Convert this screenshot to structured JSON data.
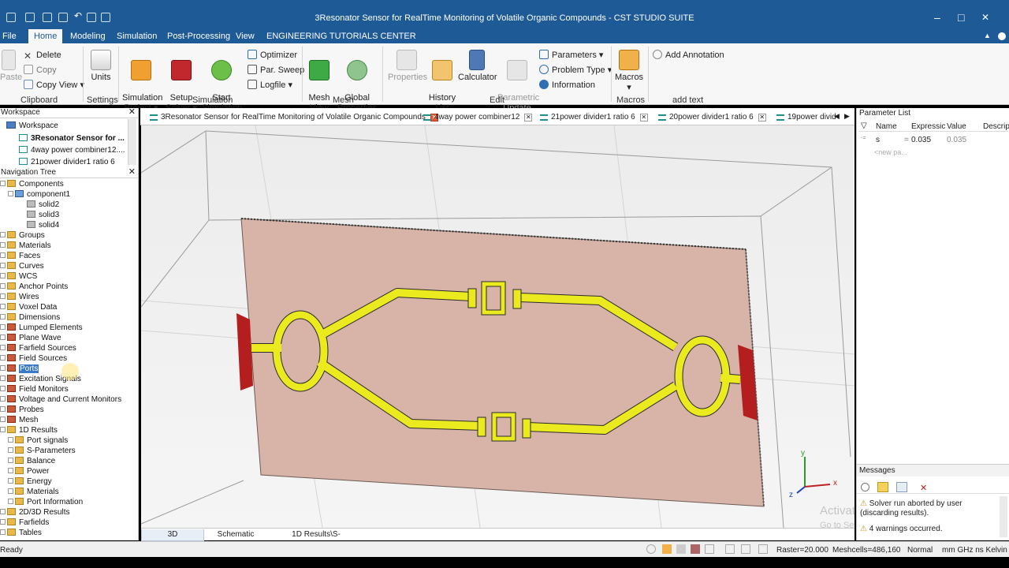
{
  "window": {
    "title": "3Resonator Sensor for RealTime Monitoring of Volatile Organic Compounds - CST STUDIO SUITE"
  },
  "menu": [
    "File",
    "Home",
    "Modeling",
    "Simulation",
    "Post-Processing",
    "View",
    "ENGINEERING TUTORIALS CENTER"
  ],
  "ribbon": {
    "clipboard": {
      "paste": "Paste",
      "delete": "Delete",
      "copy": "Copy",
      "copy_view": "Copy View",
      "group": "Clipboard"
    },
    "settings": {
      "units": "Units",
      "group": "Settings"
    },
    "simulation": {
      "sim_project": "Simulation\nProject",
      "setup_solver": "Setup\nSolver",
      "start_sim": "Start\nSimulation",
      "optimizer": "Optimizer",
      "par_sweep": "Par. Sweep",
      "logfile": "Logfile",
      "group": "Simulation"
    },
    "mesh": {
      "mesh_view": "Mesh\nView",
      "global_props": "Global\nProperties",
      "group": "Mesh"
    },
    "edit": {
      "properties": "Properties",
      "history": "History\nList",
      "calculator": "Calculator",
      "param_update": "Parametric\nUpdate",
      "parameters": "Parameters",
      "problem_type": "Problem Type",
      "information": "Information",
      "group": "Edit"
    },
    "macros": {
      "macros": "Macros",
      "group": "Macros"
    },
    "addtext": {
      "annotation": "Add Annotation",
      "group": "add text"
    }
  },
  "workspace": {
    "header": "Workspace",
    "root": "Workspace",
    "items": [
      "3Resonator Sensor for ...",
      "4way power combiner12....",
      "21power divider1 ratio 6"
    ]
  },
  "navtree": {
    "header": "Navigation Tree",
    "items": [
      {
        "label": "Components",
        "level": 0,
        "icon": "folder"
      },
      {
        "label": "component1",
        "level": 1,
        "icon": "component"
      },
      {
        "label": "solid2",
        "level": 2,
        "icon": "solid"
      },
      {
        "label": "solid3",
        "level": 2,
        "icon": "solid"
      },
      {
        "label": "solid4",
        "level": 2,
        "icon": "solid"
      },
      {
        "label": "Groups",
        "level": 0,
        "icon": "folder"
      },
      {
        "label": "Materials",
        "level": 0,
        "icon": "folder"
      },
      {
        "label": "Faces",
        "level": 0,
        "icon": "folder"
      },
      {
        "label": "Curves",
        "level": 0,
        "icon": "folder"
      },
      {
        "label": "WCS",
        "level": 0,
        "icon": "folder"
      },
      {
        "label": "Anchor Points",
        "level": 0,
        "icon": "folder"
      },
      {
        "label": "Wires",
        "level": 0,
        "icon": "folder"
      },
      {
        "label": "Voxel Data",
        "level": 0,
        "icon": "folder"
      },
      {
        "label": "Dimensions",
        "level": 0,
        "icon": "folder"
      },
      {
        "label": "Lumped Elements",
        "level": 0,
        "icon": "red"
      },
      {
        "label": "Plane Wave",
        "level": 0,
        "icon": "red"
      },
      {
        "label": "Farfield Sources",
        "level": 0,
        "icon": "red"
      },
      {
        "label": "Field Sources",
        "level": 0,
        "icon": "red"
      },
      {
        "label": "Ports",
        "level": 0,
        "icon": "red",
        "selected": true
      },
      {
        "label": "Excitation Signals",
        "level": 0,
        "icon": "red"
      },
      {
        "label": "Field Monitors",
        "level": 0,
        "icon": "red"
      },
      {
        "label": "Voltage and Current Monitors",
        "level": 0,
        "icon": "red"
      },
      {
        "label": "Probes",
        "level": 0,
        "icon": "red"
      },
      {
        "label": "Mesh",
        "level": 0,
        "icon": "red"
      },
      {
        "label": "1D Results",
        "level": 0,
        "icon": "folder"
      },
      {
        "label": "Port signals",
        "level": 1,
        "icon": "folder"
      },
      {
        "label": "S-Parameters",
        "level": 1,
        "icon": "folder"
      },
      {
        "label": "Balance",
        "level": 1,
        "icon": "folder"
      },
      {
        "label": "Power",
        "level": 1,
        "icon": "folder"
      },
      {
        "label": "Energy",
        "level": 1,
        "icon": "folder"
      },
      {
        "label": "Materials",
        "level": 1,
        "icon": "folder"
      },
      {
        "label": "Port Information",
        "level": 1,
        "icon": "folder"
      },
      {
        "label": "2D/3D Results",
        "level": 0,
        "icon": "folder"
      },
      {
        "label": "Farfields",
        "level": 0,
        "icon": "folder"
      },
      {
        "label": "Tables",
        "level": 0,
        "icon": "folder"
      }
    ]
  },
  "doc_tabs": [
    {
      "label": "3Resonator Sensor for RealTime Monitoring of Volatile Organic Compounds",
      "active": true
    },
    {
      "label": "4way power combiner12",
      "active": false
    },
    {
      "label": "21power divider1 ratio 6",
      "active": false
    },
    {
      "label": "20power divider1 ratio 6",
      "active": false
    },
    {
      "label": "19power divid",
      "active": false
    }
  ],
  "view_tabs": [
    "3D",
    "Schematic",
    "1D Results\\S-Parameters"
  ],
  "param_list": {
    "header": "Parameter List",
    "columns": [
      "Name",
      "Expressic",
      "Value",
      "Descript"
    ],
    "rows": [
      {
        "name": "s",
        "eq": "=",
        "expression": "0.035",
        "value": "0.035"
      }
    ],
    "new_row": "<new pa..."
  },
  "messages": {
    "header": "Messages",
    "items": [
      "Solver run aborted by user (discarding results).",
      "4 warnings occurred."
    ]
  },
  "watermark": {
    "line1": "Activate Windows",
    "line2": "Go to Settings to activate Windows."
  },
  "status": {
    "ready": "Ready",
    "raster": "Raster=20.000",
    "meshcells": "Meshcells=486,160",
    "normal": "Normal",
    "units": "mm GHz ns Kelvin"
  },
  "axes": {
    "x": "x",
    "y": "y",
    "z": "z"
  },
  "colors": {
    "titlebar": "#1e5a96",
    "substrate": "#d8b4a8",
    "trace": "#eaea1e",
    "port": "#b41e1e"
  }
}
